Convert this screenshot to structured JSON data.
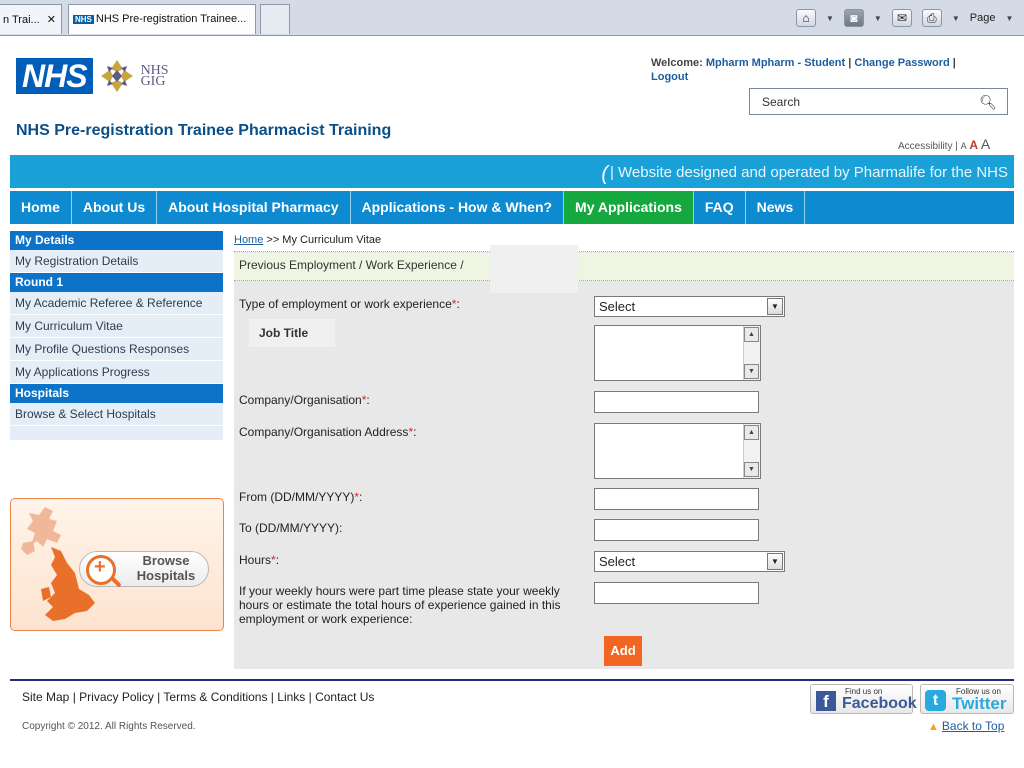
{
  "browser": {
    "tabs": [
      {
        "label": "n Trai...",
        "close": "✕"
      },
      {
        "favicon": "NHS",
        "label": "NHS Pre-registration Trainee..."
      },
      {
        "label": ""
      }
    ],
    "tools": {
      "home": "⌂",
      "rss": "◙",
      "mail": "✉",
      "print": "⎙",
      "page_menu": "Page"
    }
  },
  "header": {
    "logo_text": "NHS",
    "logo_sub_1": "NHS",
    "logo_sub_2": "GIG",
    "site_title": "NHS Pre-registration Trainee Pharmacist Training",
    "welcome_prefix": "Welcome:",
    "user_name": "Mpharm Mpharm - Student",
    "change_password": "Change Password",
    "logout": "Logout",
    "search_placeholder": "Search",
    "accessibility_label": "Accessibility |",
    "text_sizes": [
      "A",
      "A",
      "A"
    ]
  },
  "strip": {
    "text": "| Website designed and operated by Pharmalife for the NHS"
  },
  "nav": {
    "items": [
      {
        "label": "Home"
      },
      {
        "label": "About Us"
      },
      {
        "label": "About Hospital Pharmacy"
      },
      {
        "label": "Applications - How & When?"
      },
      {
        "label": "My Applications",
        "active": true
      },
      {
        "label": "FAQ"
      },
      {
        "label": "News"
      }
    ]
  },
  "sidebar": {
    "sections": [
      {
        "heading": "My Details",
        "items": [
          "My Registration Details"
        ]
      },
      {
        "heading": "Round 1",
        "items": [
          "My Academic Referee & Reference",
          "My Curriculum Vitae",
          "My Profile Questions Responses",
          "My Applications Progress"
        ]
      },
      {
        "heading": "Hospitals",
        "items": [
          "Browse & Select Hospitals"
        ]
      }
    ],
    "browse_card_label": "Browse Hospitals"
  },
  "main": {
    "breadcrumb_home": "Home",
    "breadcrumb_rest": ">> My Curriculum Vitae",
    "subtitle": "Previous Employment / Work Experience /",
    "fields": {
      "employment_type_label": "Type of employment or work experience",
      "employment_type_value": "Select",
      "job_title_label": "Job Title",
      "company_label": "Company/Organisation",
      "company_address_label": "Company/Organisation Address",
      "from_label": "From (DD/MM/YYYY)",
      "to_label": "To (DD/MM/YYYY):",
      "hours_label": "Hours",
      "hours_value": "Select",
      "parttime_label": "If your weekly hours were part time please state your weekly hours or estimate the total hours of experience gained in this employment or work experience:"
    },
    "required_mark": "*",
    "add_label": "Add"
  },
  "footer": {
    "links": [
      "Site Map",
      "Privacy Policy",
      "Terms & Conditions",
      "Links",
      "Contact Us"
    ],
    "copyright": "Copyright © 2012. All Rights Reserved.",
    "facebook_small": "Find us on",
    "facebook_big": "Facebook",
    "twitter_small": "Follow us on",
    "twitter_big": "Twitter",
    "back_to_top": "Back to Top"
  },
  "colors": {
    "nhs_blue": "#005eb8",
    "strip_blue": "#1aa2d8",
    "nav_blue": "#0d8ad0",
    "active_green": "#14a83e",
    "accent_orange": "#f26522",
    "sidebar_heading": "#0d73c9"
  }
}
